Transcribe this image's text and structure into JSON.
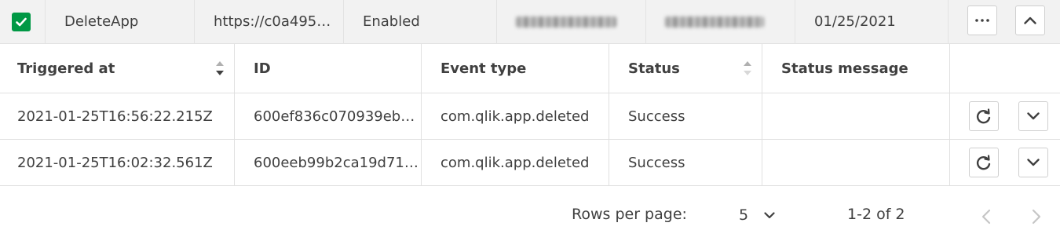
{
  "webhook": {
    "checkbox_checked": true,
    "name": "DeleteApp",
    "url": "https://c0a495…",
    "status": "Enabled",
    "owner": "",
    "created_by": "",
    "date": "01/25/2021"
  },
  "table": {
    "columns": [
      "Triggered at",
      "ID",
      "Event type",
      "Status",
      "Status message"
    ],
    "sort": {
      "column": "Triggered at",
      "direction": "descending"
    },
    "rows": [
      {
        "triggered_at": "2021-01-25T16:56:22.215Z",
        "id": "600ef836c070939eb…",
        "event_type": "com.qlik.app.deleted",
        "status": "Success",
        "status_message": ""
      },
      {
        "triggered_at": "2021-01-25T16:02:32.561Z",
        "id": "600eeb99b2ca19d71…",
        "event_type": "com.qlik.app.deleted",
        "status": "Success",
        "status_message": ""
      }
    ]
  },
  "pagination": {
    "rows_per_page_label": "Rows per page:",
    "rows_per_page": "5",
    "range": "1-2 of 2"
  },
  "colors": {
    "accent_green": "#009845",
    "border": "#e0e0e0",
    "header_bg": "#f2f2f2"
  },
  "icons": [
    "check-icon",
    "more-icon",
    "collapse-icon",
    "sort-icon",
    "retry-icon",
    "expand-icon",
    "chevron-down-icon",
    "prev-page-icon",
    "next-page-icon"
  ]
}
